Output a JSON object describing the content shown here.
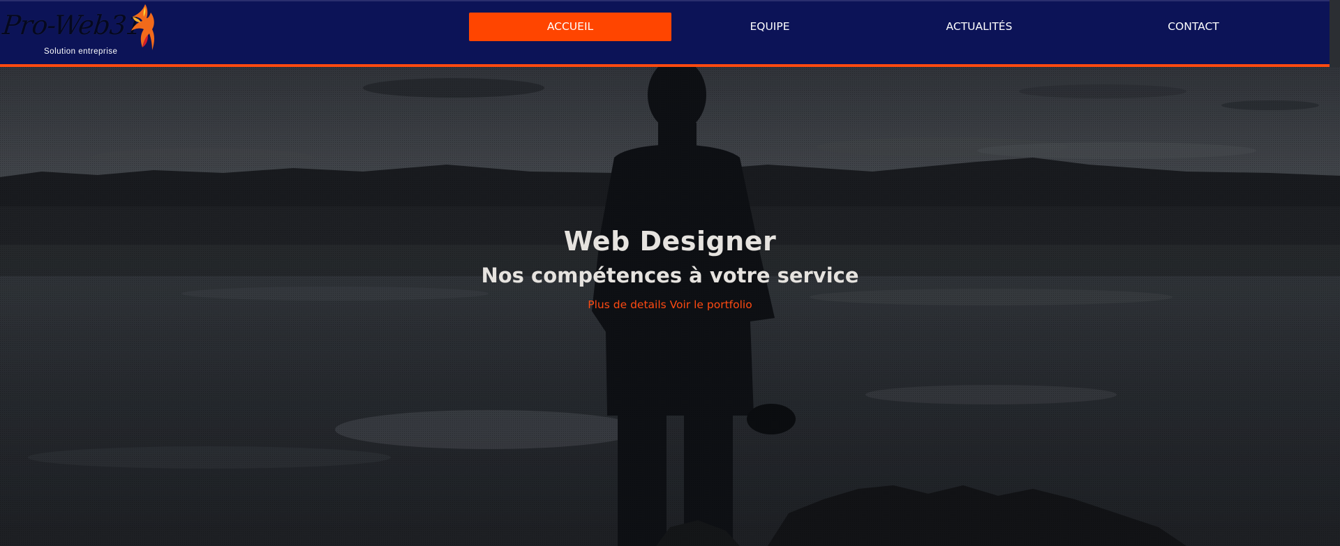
{
  "brand": {
    "logo_text": "Pro-Web31",
    "tagline": "Solution entreprise",
    "logo_icon": "phoenix-icon"
  },
  "nav": {
    "items": [
      {
        "label": "ACCUEIL",
        "active": true
      },
      {
        "label": "EQUIPE",
        "active": false
      },
      {
        "label": "ACTUALITÉS",
        "active": false
      },
      {
        "label": "CONTACT",
        "active": false
      }
    ]
  },
  "hero": {
    "title": "Web Designer",
    "subtitle": "Nos compétences à votre service",
    "link_details": "Plus de details",
    "link_portfolio": "Voir le portfolio"
  },
  "colors": {
    "header_bg": "#0c1357",
    "accent": "#ff4500",
    "hero_text": "#e6e3df"
  }
}
